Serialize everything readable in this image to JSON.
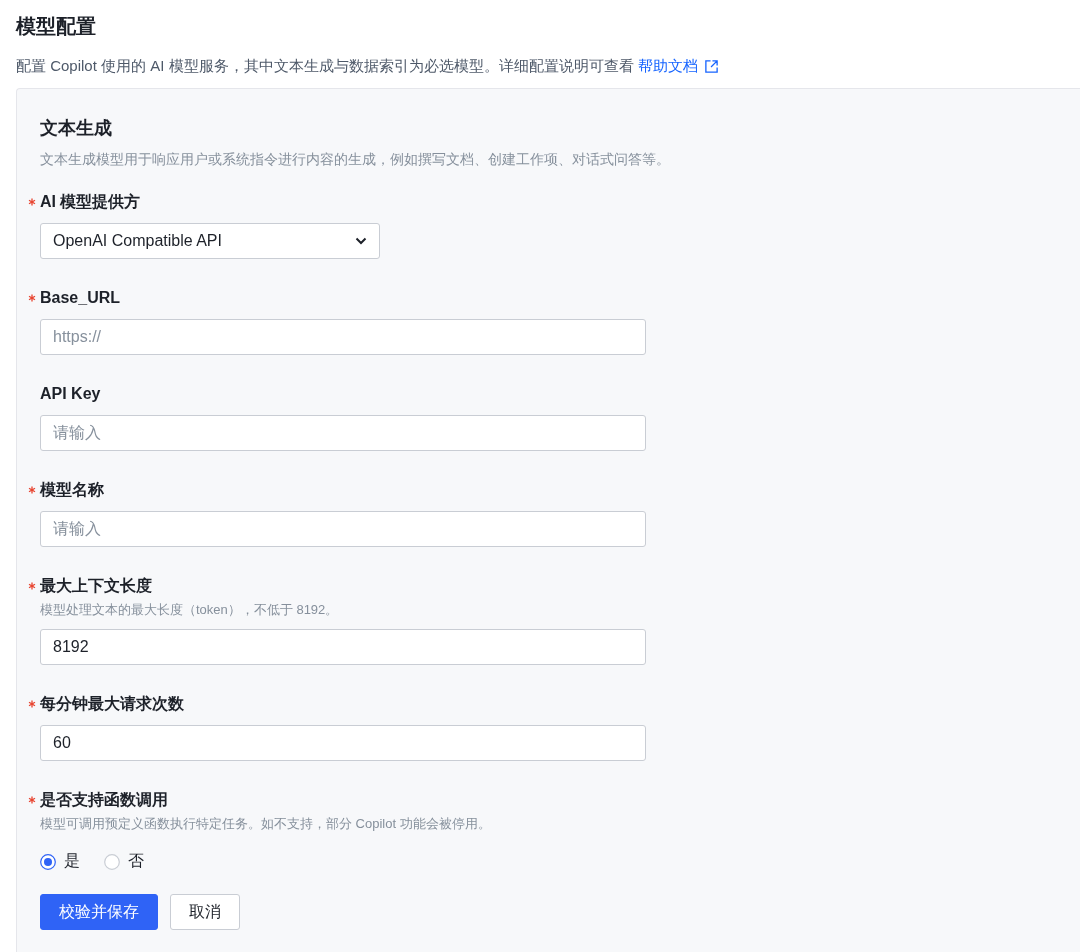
{
  "page": {
    "title": "模型配置",
    "description": "配置 Copilot 使用的 AI 模型服务，其中文本生成与数据索引为必选模型。详细配置说明可查看",
    "help_link": "帮助文档"
  },
  "section": {
    "title": "文本生成",
    "description": "文本生成模型用于响应用户或系统指令进行内容的生成，例如撰写文档、创建工作项、对话式问答等。",
    "fields": [
      {
        "kind": "select",
        "label": "AI 模型提供方",
        "required": true,
        "value": "OpenAI Compatible API"
      },
      {
        "kind": "text",
        "label": "Base_URL",
        "required": true,
        "placeholder": "https://"
      },
      {
        "kind": "text",
        "label": "API Key",
        "required": false,
        "placeholder": "请输入"
      },
      {
        "kind": "text",
        "label": "模型名称",
        "required": true,
        "placeholder": "请输入"
      },
      {
        "kind": "text",
        "label": "最大上下文长度",
        "required": true,
        "hint": "模型处理文本的最大长度（token），不低于 8192。",
        "value": "8192"
      },
      {
        "kind": "text",
        "label": "每分钟最大请求次数",
        "required": true,
        "value": "60"
      },
      {
        "kind": "radio",
        "label": "是否支持函数调用",
        "required": true,
        "hint": "模型可调用预定义函数执行特定任务。如不支持，部分 Copilot 功能会被停用。",
        "options": [
          {
            "label": "是",
            "selected": true
          },
          {
            "label": "否",
            "selected": false
          }
        ]
      }
    ],
    "buttons": [
      {
        "kind": "primary",
        "label": "校验并保存"
      },
      {
        "kind": "secondary",
        "label": "取消"
      }
    ]
  }
}
